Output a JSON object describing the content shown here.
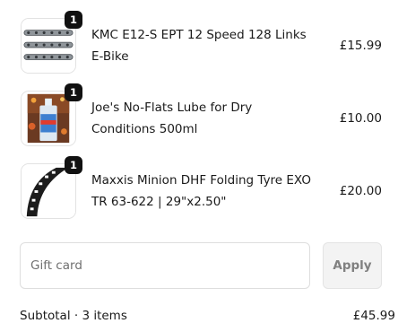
{
  "cart": {
    "items": [
      {
        "quantity": "1",
        "name": "KMC E12-S EPT 12 Speed 128 Links E-Bike",
        "price": "£15.99",
        "image_icon": "bike-chain-image"
      },
      {
        "quantity": "1",
        "name": "Joe's No-Flats Lube for Dry Conditions 500ml",
        "price": "£10.00",
        "image_icon": "lube-bottle-image"
      },
      {
        "quantity": "1",
        "name": "Maxxis Minion DHF Folding Tyre EXO TR 63-622 | 29\"x2.50\"",
        "price": "£20.00",
        "image_icon": "tyre-image"
      }
    ]
  },
  "gift_card": {
    "value": "",
    "placeholder": "Gift card",
    "apply_label": "Apply"
  },
  "summary": {
    "subtotal_label": "Subtotal · 3 items",
    "subtotal_value": "£45.99"
  }
}
